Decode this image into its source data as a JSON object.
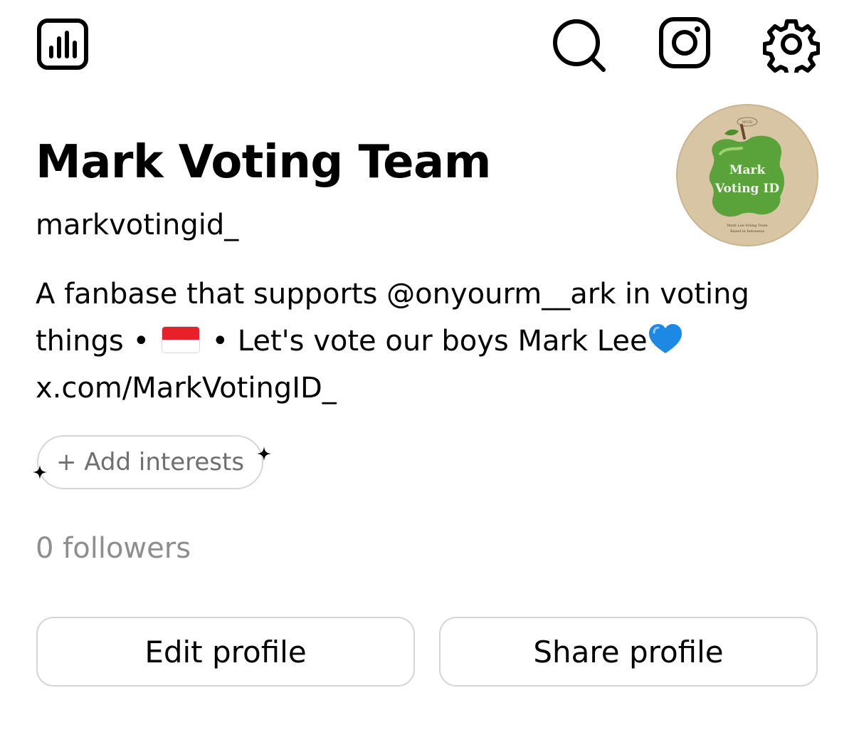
{
  "toolbar": {
    "left_icon": "insights-icon",
    "right_icons": [
      "search-icon",
      "instagram-icon",
      "settings-icon"
    ]
  },
  "profile": {
    "display_name": "Mark Voting Team",
    "username": "markvotingid_",
    "avatar": {
      "top_text": "MVID",
      "line1": "Mark",
      "line2": "Voting ID",
      "caption_line1": "Mark Lee Voting Team",
      "caption_line2": "Based in Indonesia"
    },
    "bio": {
      "line1": "A fanbase that supports @onyourm__ark in voting",
      "line2_start": "things • ",
      "flag": "indonesia-flag",
      "line2_end": " • Let's vote our boys Mark Lee",
      "heart": "blue-heart",
      "link": "x.com/MarkVotingID_"
    },
    "interests_button": "+ Add interests",
    "followers": "0 followers"
  },
  "actions": {
    "edit_label": "Edit profile",
    "share_label": "Share profile"
  },
  "colors": {
    "text": "#000000",
    "muted": "#8e8e8e",
    "border": "#d6d6d6",
    "avatar_bg": "#d8c5a4",
    "apple_green": "#5aa33a",
    "heart_blue": "#1e88e5",
    "flag_red": "#e8202a"
  }
}
